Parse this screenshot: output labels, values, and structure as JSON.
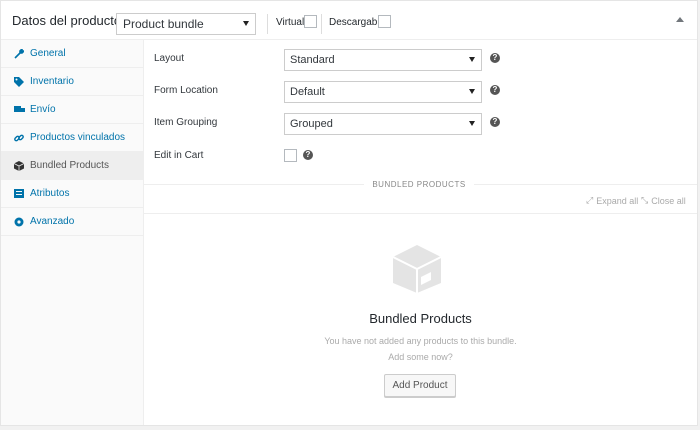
{
  "header": {
    "title": "Datos del producto —",
    "product_type": "Product bundle",
    "virtual_label": "Virtual:",
    "downloadable_label": "Descargable:"
  },
  "sidebar": {
    "items": [
      {
        "label": "General",
        "icon": "wrench-icon"
      },
      {
        "label": "Inventario",
        "icon": "tag-icon"
      },
      {
        "label": "Envío",
        "icon": "truck-icon"
      },
      {
        "label": "Productos vinculados",
        "icon": "link-icon"
      },
      {
        "label": "Bundled Products",
        "icon": "box-icon",
        "active": true
      },
      {
        "label": "Atributos",
        "icon": "list-icon"
      },
      {
        "label": "Avanzado",
        "icon": "gear-icon"
      }
    ]
  },
  "form": {
    "layout_label": "Layout",
    "layout_value": "Standard",
    "form_location_label": "Form Location",
    "form_location_value": "Default",
    "item_grouping_label": "Item Grouping",
    "item_grouping_value": "Grouped",
    "edit_in_cart_label": "Edit in Cart"
  },
  "bundled": {
    "section_title": "BUNDLED PRODUCTS",
    "expand_all": "Expand all",
    "close_all": "Close all",
    "empty_title": "Bundled Products",
    "empty_text": "You have not added any products to this bundle.",
    "empty_sub": "Add some now?",
    "add_button": "Add Product"
  },
  "help_glyph": "?",
  "colors": {
    "link": "#0073aa",
    "active_bg": "#eeeeee"
  }
}
